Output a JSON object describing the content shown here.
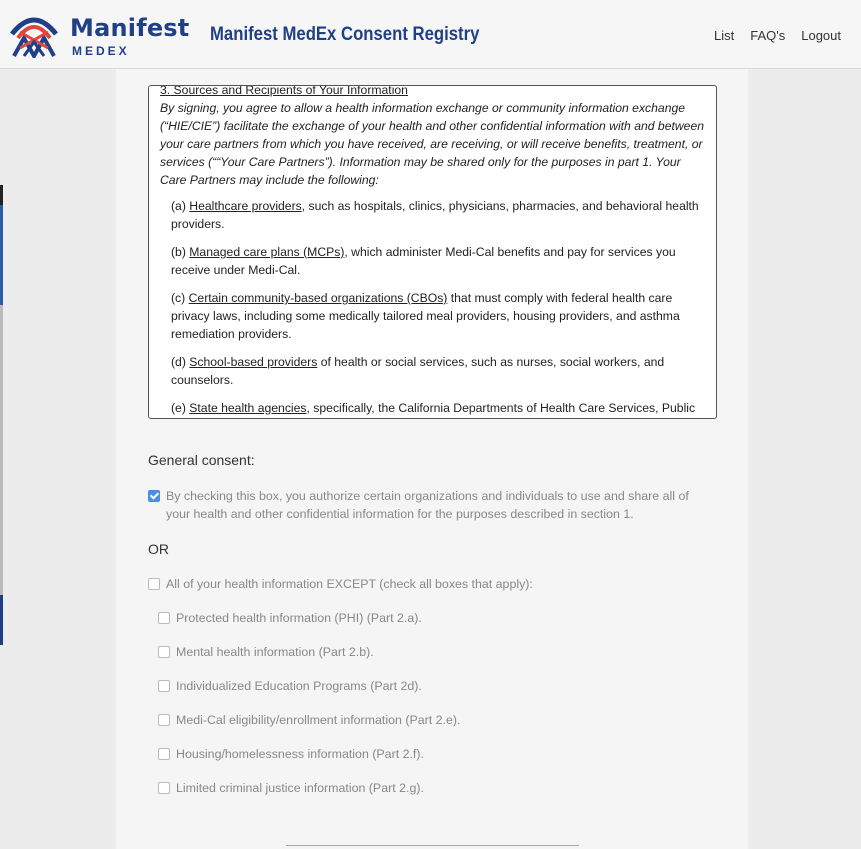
{
  "header": {
    "logo_name": "Manifest",
    "logo_sub": "MEDEX",
    "app_title": "Manifest MedEx Consent Registry",
    "nav": [
      "List",
      "FAQ's",
      "Logout"
    ]
  },
  "consent_text": {
    "section_heading": "3. Sources and Recipients of Your Information",
    "intro": "By signing, you agree to allow a health information exchange or community information exchange (“HIE/CIE”) facilitate the exchange of your health and other confidential information with and between your care partners from which you have received, are receiving, or will receive benefits, treatment, or services (““Your Care Partners”). Information may be shared only for the purposes in part 1. Your Care Partners may include the following:",
    "items": [
      {
        "prefix": "(a) ",
        "term": "Healthcare providers",
        "rest": ", such as hospitals, clinics, physicians, pharmacies, and behavioral health providers."
      },
      {
        "prefix": "(b) ",
        "term": "Managed care plans (MCPs)",
        "rest": ", which administer Medi-Cal benefits and pay for services you receive under Medi-Cal."
      },
      {
        "prefix": "(c) ",
        "term": "Certain community-based organizations (CBOs)",
        "rest": " that must comply with federal health care privacy laws, including some medically tailored meal providers, housing providers, and asthma remediation providers."
      },
      {
        "prefix": "(d) ",
        "term": "School-based providers",
        "rest": " of health or social services, such as nurses, social workers, and counselors."
      },
      {
        "prefix": "(e) ",
        "term": "State health agencies",
        "rest": ", specifically, the California Departments of Health Care Services, Public"
      }
    ]
  },
  "general_consent": {
    "label": "General consent:",
    "checkbox_text": "By checking this box, you authorize certain organizations and individuals to use and share all of your health and other confidential information for the purposes described in section 1.",
    "checked": true
  },
  "or_label": "OR",
  "except_option": {
    "text": "All of your health information EXCEPT (check all boxes that apply):",
    "checked": false
  },
  "except_items": [
    "Protected health information (PHI) (Part 2.a).",
    "Mental health information (Part 2.b).",
    "Individualized Education Programs (Part 2d).",
    "Medi-Cal eligibility/enrollment information (Part 2.e).",
    "Housing/homelessness information (Part 2.f).",
    "Limited criminal justice information (Part 2.g)."
  ],
  "colors": {
    "brand": "#1f3f86",
    "accent": "#e0463a",
    "checkbox_checked": "#4a90e2"
  }
}
